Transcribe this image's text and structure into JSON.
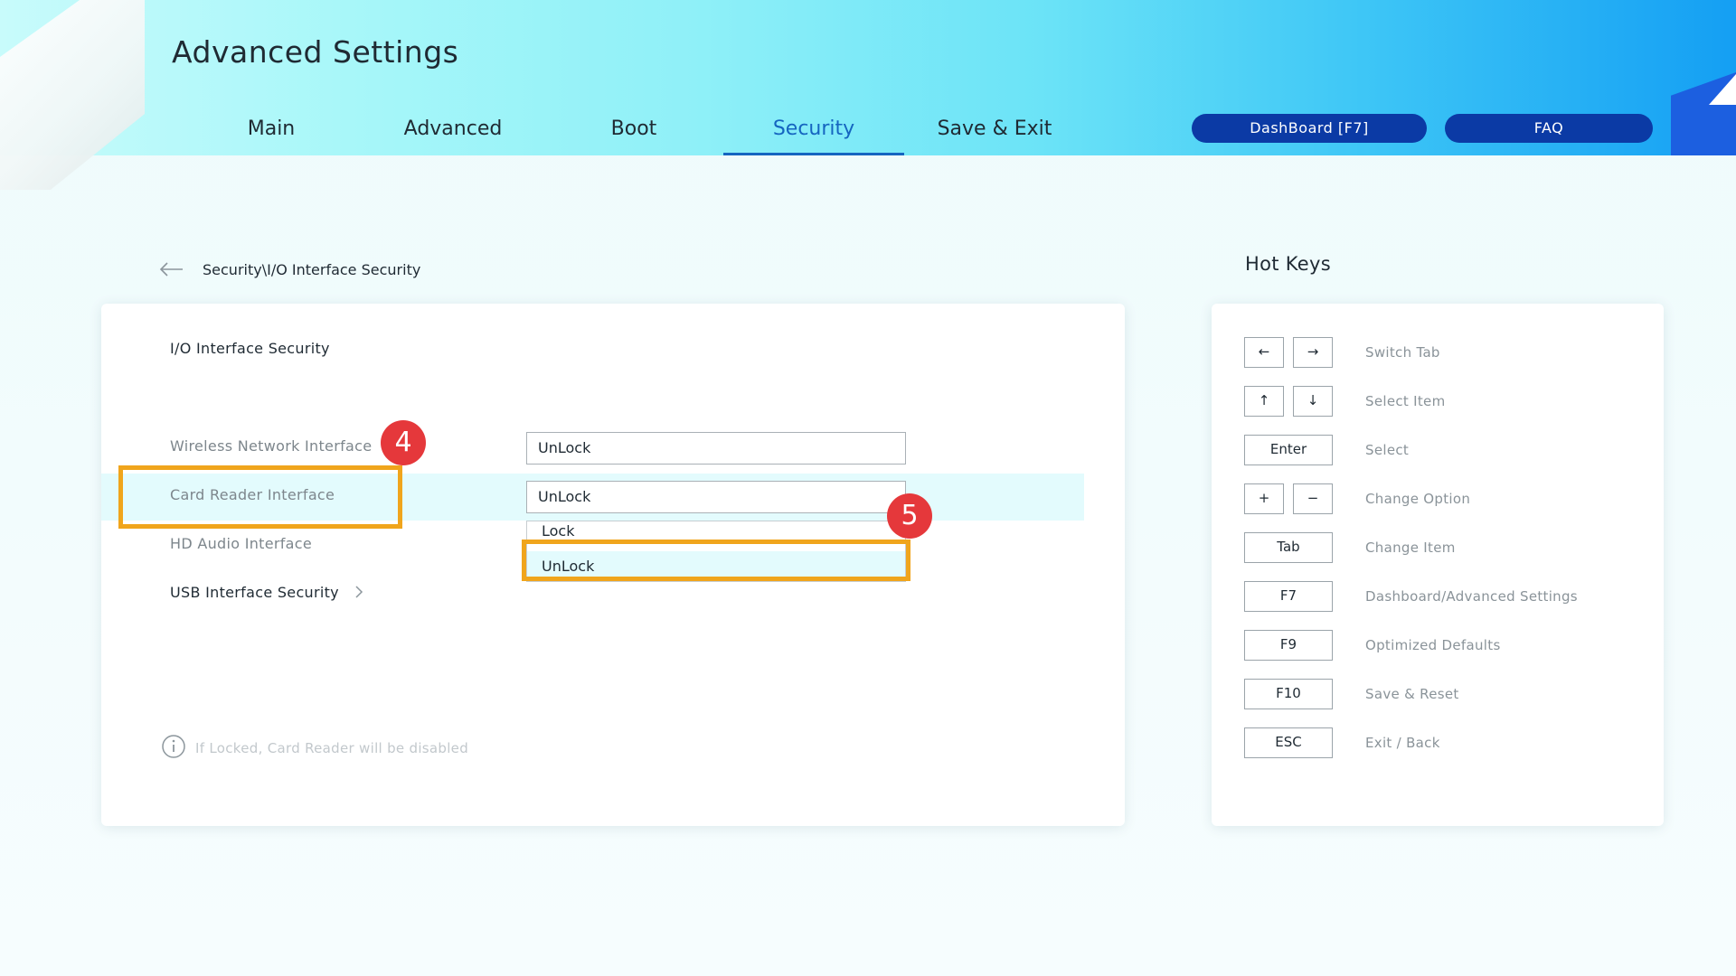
{
  "app_title": "Advanced Settings",
  "tabs": [
    {
      "label": "Main",
      "active": false
    },
    {
      "label": "Advanced",
      "active": false
    },
    {
      "label": "Boot",
      "active": false
    },
    {
      "label": "Security",
      "active": true
    },
    {
      "label": "Save & Exit",
      "active": false
    }
  ],
  "header_buttons": {
    "dashboard": "DashBoard [F7]",
    "faq": "FAQ"
  },
  "breadcrumb": "Security\\I/O Interface Security",
  "section_title": "I/O Interface Security",
  "items": [
    {
      "label": "Wireless Network Interface",
      "value": "UnLock"
    },
    {
      "label": "Card Reader Interface",
      "value": "UnLock"
    },
    {
      "label": "HD Audio Interface"
    },
    {
      "label": "USB Interface Security"
    }
  ],
  "dropdown": {
    "options": [
      "Lock",
      "UnLock"
    ],
    "selected": "UnLock"
  },
  "info_text": "If Locked, Card Reader will be disabled",
  "annotations": {
    "step_a": "4",
    "step_b": "5"
  },
  "hotkeys": {
    "title": "Hot Keys",
    "rows": [
      {
        "keys": [
          "←",
          "→"
        ],
        "desc": "Switch Tab"
      },
      {
        "keys": [
          "↑",
          "↓"
        ],
        "desc": "Select Item"
      },
      {
        "keys": [
          "Enter"
        ],
        "desc": "Select"
      },
      {
        "keys": [
          "+",
          "−"
        ],
        "desc": "Change Option"
      },
      {
        "keys": [
          "Tab"
        ],
        "desc": "Change Item"
      },
      {
        "keys": [
          "F7"
        ],
        "desc": "Dashboard/Advanced Settings"
      },
      {
        "keys": [
          "F9"
        ],
        "desc": "Optimized Defaults"
      },
      {
        "keys": [
          "F10"
        ],
        "desc": "Save & Reset"
      },
      {
        "keys": [
          "ESC"
        ],
        "desc": "Exit / Back"
      }
    ]
  },
  "colors": {
    "accent": "#1565c0",
    "pill": "#0b3aa5",
    "highlight": "#e3fbfd",
    "annotation": "#f0a51c",
    "badge": "#e5383b"
  }
}
